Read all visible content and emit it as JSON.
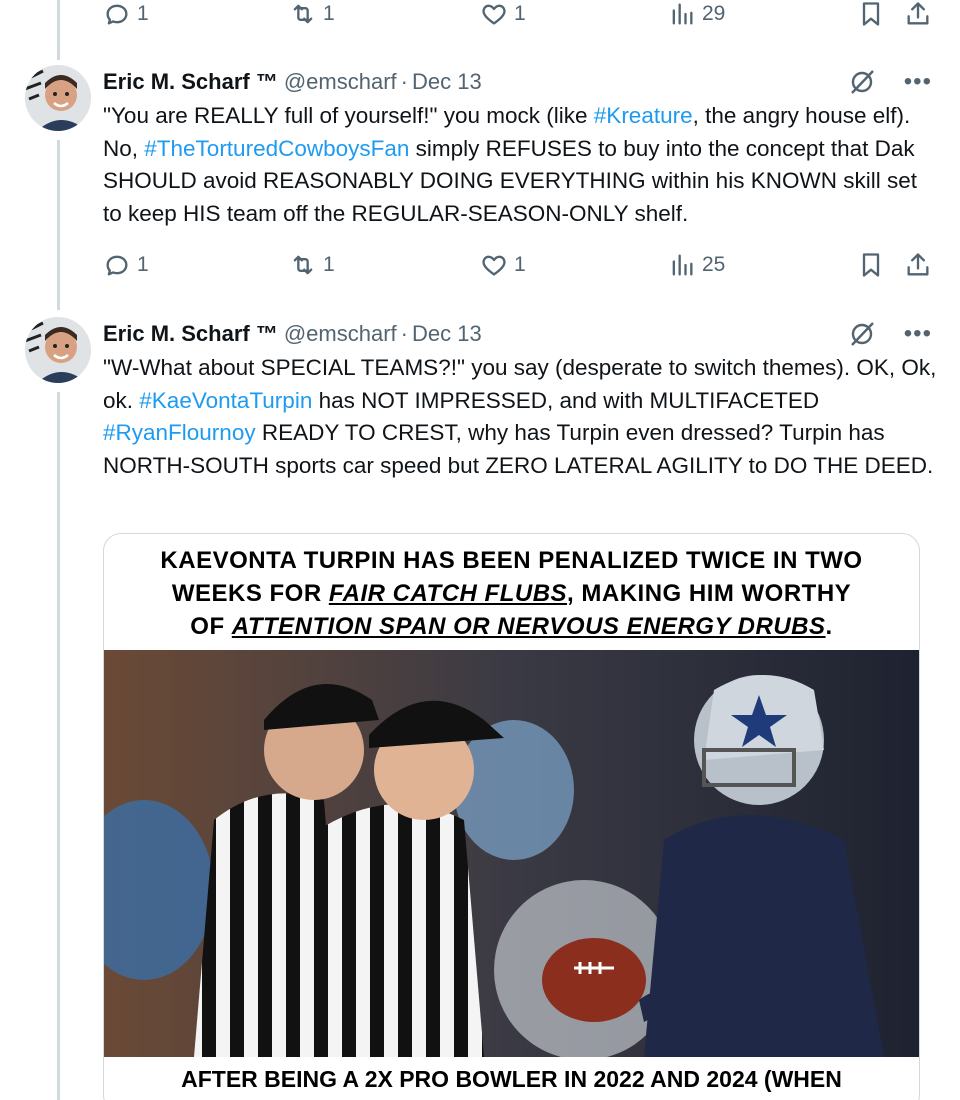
{
  "top_actions": {
    "replies": "1",
    "reposts": "1",
    "likes": "1",
    "views": "29"
  },
  "tweets": [
    {
      "author_name": "Eric M. Scharf ™",
      "handle": "@emscharf",
      "separator": "·",
      "date": "Dec 13",
      "text": [
        "\"You are REALLY full of yourself!\" you mock (like ",
        "#Kreature",
        ", the angry house elf). No, ",
        "#TheTorturedCowboysFan",
        " simply REFUSES to buy into the concept that Dak SHOULD avoid REASONABLY DOING EVERYTHING within his KNOWN skill set to keep HIS team off the REGULAR-SEASON-ONLY shelf."
      ],
      "actions": {
        "replies": "1",
        "reposts": "1",
        "likes": "1",
        "views": "25"
      }
    },
    {
      "author_name": "Eric M. Scharf ™",
      "handle": "@emscharf",
      "separator": "·",
      "date": "Dec 13",
      "text": [
        "\"W-What about SPECIAL TEAMS?!\" you say (desperate to switch themes). OK, Ok, ok. ",
        "#KaeVontaTurpin",
        " has NOT IMPRESSED, and with MULTIFACETED ",
        "#RyanFlournoy",
        " READY TO CREST, why has Turpin even dressed? Turpin has NORTH-SOUTH sports car speed but ZERO LATERAL AGILITY to DO THE DEED."
      ],
      "media": {
        "caption_line1": "KAEVONTA TURPIN HAS BEEN PENALIZED TWICE IN TWO",
        "caption_line2_a": "WEEKS FOR ",
        "caption_line2_b": "FAIR CATCH FLUBS",
        "caption_line2_c": ", MAKING HIM WORTHY",
        "caption_line3_a": "OF ",
        "caption_line3_b": "ATTENTION SPAN OR NERVOUS ENERGY DRUBS",
        "caption_line3_c": ".",
        "bottom_caption": "AFTER BEING A 2X PRO BOWLER IN 2022 AND 2024 (WHEN"
      }
    }
  ],
  "colors": {
    "link": "#1d9bf0",
    "muted": "#536471",
    "thread": "#cfd9de"
  }
}
